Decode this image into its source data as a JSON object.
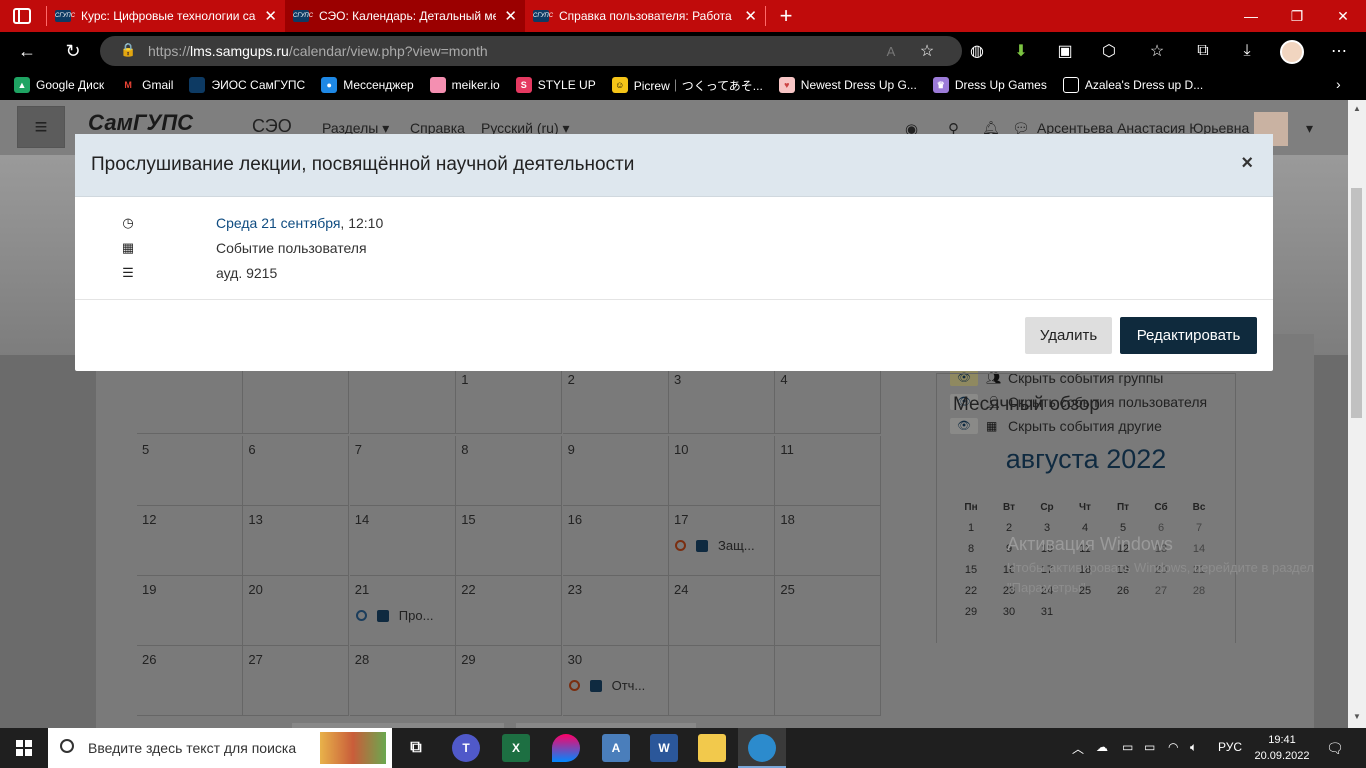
{
  "browser": {
    "tabs": [
      {
        "title": "Курс: Цифровые технологии са",
        "active": false
      },
      {
        "title": "СЭО: Календарь: Детальный ме",
        "active": true
      },
      {
        "title": "Справка пользователя: Работа",
        "active": false
      }
    ],
    "url_scheme": "https://",
    "url_host": "lms.samgups.ru",
    "url_path": "/calendar/view.php?view=month",
    "bookmarks": [
      "Google Диск",
      "Gmail",
      "ЭИОС СамГУПС",
      "Мессенджер",
      "meiker.io",
      "STYLE UP",
      "Picrew｜つくってあそ...",
      "Newest Dress Up G...",
      "Dress Up Games",
      "Azalea's Dress up D..."
    ]
  },
  "site": {
    "logo_text": "СамГУПС",
    "name": "СЭО",
    "nav": [
      "Разделы",
      "Справка",
      "Русский (ru)"
    ],
    "user_name": "Арсентьева Анастасия Юрьевна"
  },
  "calendar": {
    "weeks": [
      [
        "",
        "",
        "",
        "1",
        "2",
        "3",
        "4"
      ],
      [
        "5",
        "6",
        "7",
        "8",
        "9",
        "10",
        "11"
      ],
      [
        "12",
        "13",
        "14",
        "15",
        "16",
        "17",
        "18"
      ],
      [
        "19",
        "20",
        "21",
        "22",
        "23",
        "24",
        "25"
      ],
      [
        "26",
        "27",
        "28",
        "29",
        "30",
        "",
        ""
      ]
    ],
    "events": [
      {
        "day": "17",
        "label": "Защ..."
      },
      {
        "day": "21",
        "label": "Про..."
      },
      {
        "day": "30",
        "label": "Отч..."
      }
    ]
  },
  "sidebar": {
    "filters": [
      "Скрыть события группы",
      "Скрыть события пользователя",
      "Скрыть события другие"
    ],
    "overview_title": "Месячный обзор",
    "mini_month": "августа 2022",
    "weekdays": [
      "Пн",
      "Вт",
      "Ср",
      "Чт",
      "Пт",
      "Сб",
      "Вс"
    ],
    "mini_weeks": [
      [
        "1",
        "2",
        "3",
        "4",
        "5",
        "6",
        "7"
      ],
      [
        "8",
        "9",
        "10",
        "11",
        "12",
        "13",
        "14"
      ],
      [
        "15",
        "16",
        "17",
        "18",
        "19",
        "20",
        "21"
      ],
      [
        "22",
        "23",
        "24",
        "25",
        "26",
        "27",
        "28"
      ],
      [
        "29",
        "30",
        "31",
        "",
        "",
        "",
        ""
      ]
    ]
  },
  "watermark": {
    "line1": "Активация Windows",
    "line2": "Чтобы активировать Windows, перейдите в раздел \"Параметры\"."
  },
  "modal": {
    "title": "Прослушивание лекции, посвящённой научной деятельности",
    "close": "×",
    "date_link": "Среда 21 сентября",
    "time": ", 12:10",
    "type": "Событие пользователя",
    "location": "ауд. 9215",
    "delete_label": "Удалить",
    "edit_label": "Редактировать"
  },
  "taskbar": {
    "search_placeholder": "Введите здесь текст для поиска",
    "lang": "РУС",
    "time": "19:41",
    "date": "20.09.2022"
  }
}
